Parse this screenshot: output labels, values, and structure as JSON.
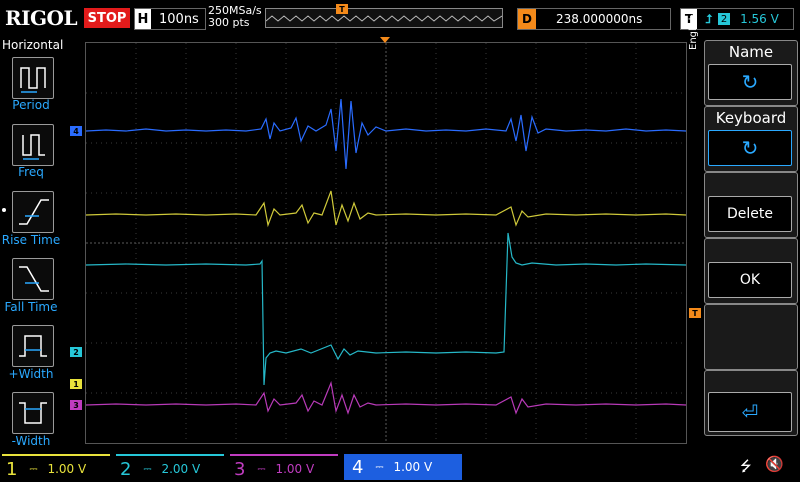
{
  "topbar": {
    "logo": "RIGOL",
    "run_status": "STOP",
    "h_label": "H",
    "timebase": "100ns",
    "sample_rate": "250MSa/s",
    "memory_depth": "300 pts",
    "trigger_pos_marker": "T",
    "d_label": "D",
    "delay": "238.000000ns",
    "t_label": "T",
    "trigger_channel": "2",
    "trigger_level": "1.56 V"
  },
  "left_menu": {
    "title": "Horizontal",
    "items": [
      {
        "label": "Period"
      },
      {
        "label": "Freq"
      },
      {
        "label": "Rise Time"
      },
      {
        "label": "Fall Time"
      },
      {
        "label": "+Width"
      },
      {
        "label": "-Width"
      }
    ]
  },
  "right_menu": {
    "language": "English",
    "name_title": "Name",
    "keyboard_title": "Keyboard",
    "delete_label": "Delete",
    "ok_label": "OK"
  },
  "markers": {
    "ch4": "4",
    "ch2": "2",
    "ch1": "1",
    "ch3": "3",
    "trigger": "T"
  },
  "channels": [
    {
      "num": "1",
      "scale": "1.00 V",
      "color": "#e8e23c"
    },
    {
      "num": "2",
      "scale": "2.00 V",
      "color": "#26c7d8"
    },
    {
      "num": "3",
      "scale": "1.00 V",
      "color": "#c03cc0"
    },
    {
      "num": "4",
      "scale": "1.00 V",
      "color": "#2a6cff"
    }
  ],
  "colors": {
    "ch1": "#e8e23c",
    "ch2": "#26c7d8",
    "ch3": "#c03cc0",
    "ch4": "#2a6cff",
    "stop": "#e21b1b",
    "delay": "#f48a1a",
    "accent": "#2aa9ff"
  }
}
